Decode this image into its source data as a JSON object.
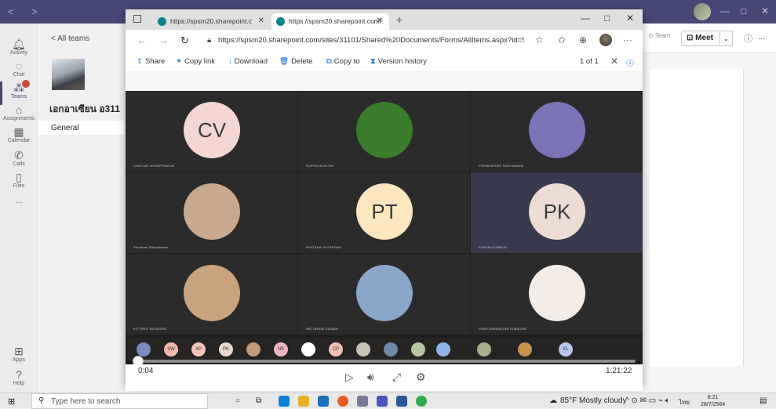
{
  "teams": {
    "nav": "< >",
    "rail": [
      {
        "label": "Activity",
        "icon": "bell-icon"
      },
      {
        "label": "Chat",
        "icon": "chat-icon"
      },
      {
        "label": "Teams",
        "icon": "teams-icon"
      },
      {
        "label": "Assignments",
        "icon": "assignments-icon"
      },
      {
        "label": "Calendar",
        "icon": "calendar-icon"
      },
      {
        "label": "Calls",
        "icon": "phone-icon"
      },
      {
        "label": "Files",
        "icon": "file-icon"
      },
      {
        "label": "Apps",
        "icon": "apps-icon"
      },
      {
        "label": "Help",
        "icon": "help-icon"
      }
    ],
    "more": "...",
    "all_teams": "< All teams",
    "team_name": "เอกอาเซียน อ311",
    "channel": "General",
    "team_button": "Team",
    "meet_button": "Meet",
    "meet_caret": "⌄",
    "info": "ⓘ",
    "more_actions": "..."
  },
  "edge": {
    "tabs": [
      {
        "title": "https://spsm20.sharepoint.c"
      },
      {
        "title": "https://spsm20.sharepoint.com/:"
      }
    ],
    "new_tab": "+",
    "url": "https://spsm20.sharepoint.com/sites/31101/Shared%20Documents/Forms/AllItems.aspx?id=%2...",
    "commands": {
      "share": "Share",
      "copy_link": "Copy link",
      "download": "Download",
      "delete": "Delete",
      "copy_to": "Copy to",
      "version_history": "Version history"
    },
    "pager": "1 of 1"
  },
  "video": {
    "participants": [
      {
        "initials": "CV",
        "name": "CHATJAR WONGPRAKUB",
        "color": "#f4d6d2"
      },
      {
        "initials": "",
        "name": "SUPHICHAYA WK",
        "color": "#3a7d2c"
      },
      {
        "initials": "",
        "name": "PORNNAPHAT PANYAKAEW",
        "color": "#7b74b8"
      },
      {
        "initials": "",
        "name": "Phudanai Ruksakkaew",
        "color": "#c8a98d"
      },
      {
        "initials": "PT",
        "name": "PRATANA THITAPONG",
        "color": "#fde6c0"
      },
      {
        "initials": "PK",
        "name": "PHASIN KOMKUN",
        "color": "#ecdcd4"
      },
      {
        "initials": "",
        "name": "KITTIPOT BOONSIRI",
        "color": "#c9a27e"
      },
      {
        "initials": "",
        "name": "NATTAMON SAISAM",
        "color": "#8aa6c8"
      },
      {
        "initials": "",
        "name": "PHATCHARAKORN SUBSOOK",
        "color": "#f3ebe6"
      }
    ],
    "mini_strip": [
      {
        "initials": "",
        "color": "#7a8cc0"
      },
      {
        "initials": "SW",
        "color": "#f4b9a8"
      },
      {
        "initials": "AP",
        "color": "#f7c6b8"
      },
      {
        "initials": "PK",
        "color": "#e8d8d0"
      },
      {
        "initials": "",
        "color": "#c29b7c"
      },
      {
        "initials": "NS",
        "color": "#f2b6c3"
      },
      {
        "initials": "",
        "color": "#ffffff"
      },
      {
        "initials": "CP",
        "color": "#f7c1b2"
      },
      {
        "initials": "",
        "color": "#c9c3b3"
      },
      {
        "initials": "",
        "color": "#6d8aa6"
      },
      {
        "initials": "",
        "color": "#b8c7a2"
      },
      {
        "initials": "",
        "color": "#8fb6e8"
      },
      {
        "initials": "",
        "color": "#a6b08a"
      },
      {
        "initials": "",
        "color": "#c8924e"
      },
      {
        "initials": "KL",
        "color": "#b9c7ef"
      }
    ],
    "current_time": "0:04",
    "total_time": "1:21:22",
    "progress": 0.003
  },
  "taskbar": {
    "search_placeholder": "Type here to search",
    "weather": "85°F  Mostly cloudy",
    "lang": "ไทย",
    "time": "8:21",
    "date": "28/7/2564"
  }
}
